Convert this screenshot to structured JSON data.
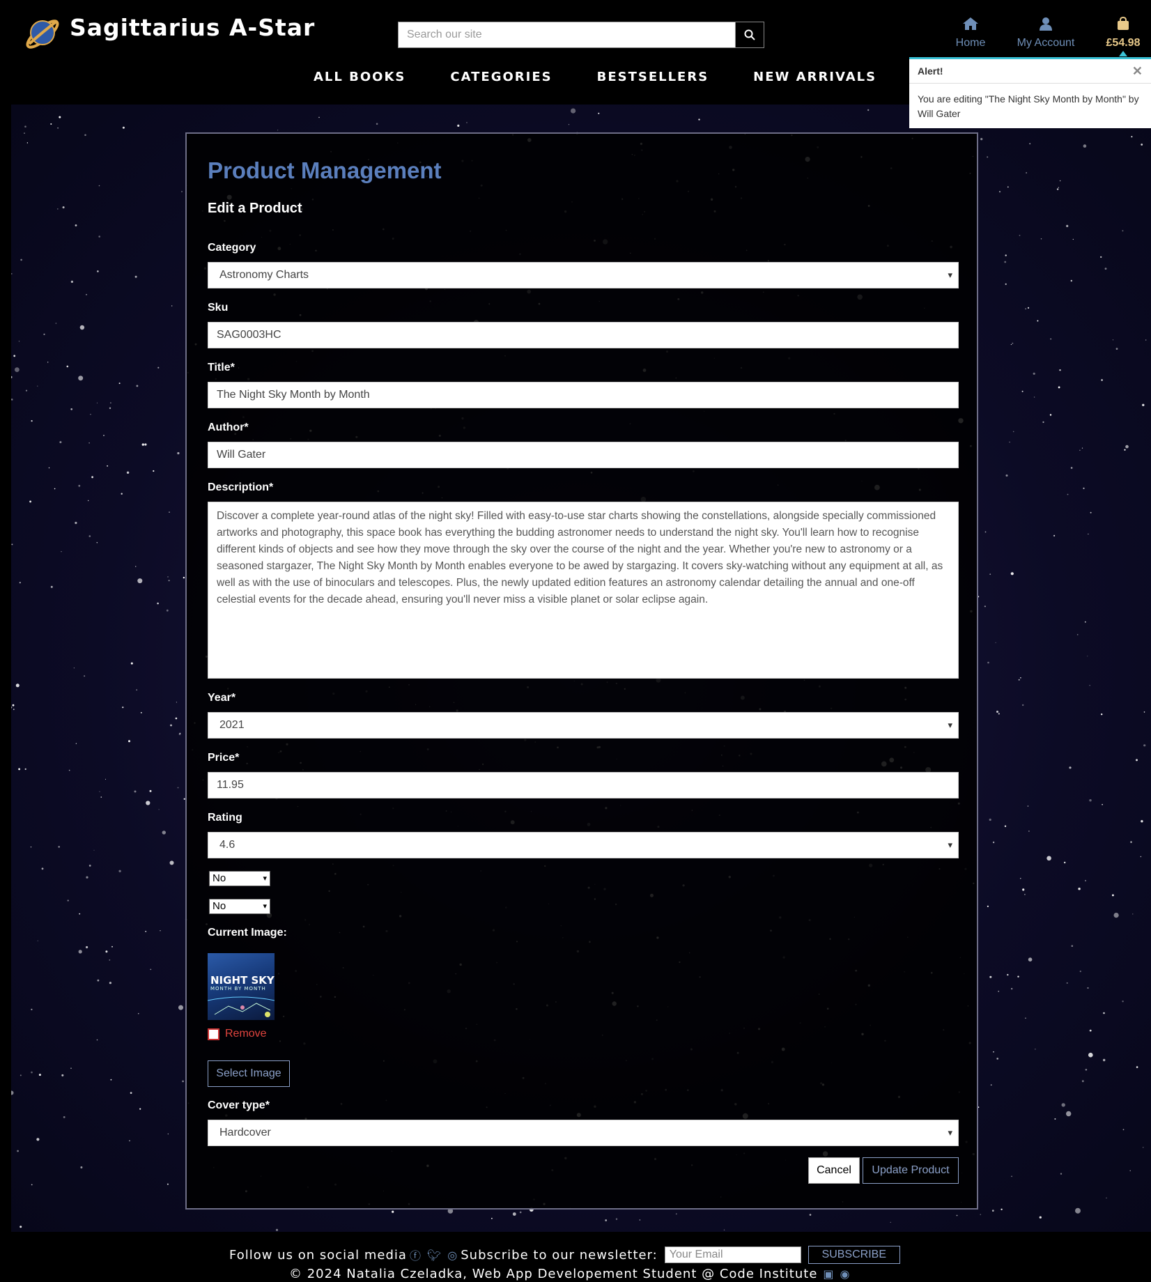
{
  "brand": {
    "name": "Sagittarius A-Star"
  },
  "search": {
    "placeholder": "Search our site"
  },
  "top_nav": {
    "home_label": "Home",
    "account_label": "My Account",
    "bag_total": "£54.98"
  },
  "main_menu": [
    "ALL BOOKS",
    "CATEGORIES",
    "BESTSELLERS",
    "NEW ARRIVALS"
  ],
  "alert": {
    "title": "Alert!",
    "message": "You are editing \"The Night Sky Month by Month\" by Will Gater"
  },
  "form": {
    "title": "Product Management",
    "subtitle": "Edit a Product",
    "category_label": "Category",
    "category_value": "Astronomy Charts",
    "sku_label": "Sku",
    "sku_value": "SAG0003HC",
    "title_label": "Title*",
    "title_value": "The Night Sky Month by Month",
    "author_label": "Author*",
    "author_value": "Will Gater",
    "description_label": "Description*",
    "description_value": "Discover a complete year-round atlas of the night sky! Filled with easy-to-use star charts showing the constellations, alongside specially commissioned artworks and photography, this space book has everything the budding astronomer needs to understand the night sky. You'll learn how to recognise different kinds of objects and see how they move through the sky over the course of the night and the year. Whether you're new to astronomy or a seasoned stargazer, The Night Sky Month by Month enables everyone to be awed by stargazing. It covers sky-watching without any equipment at all, as well as with the use of binoculars and telescopes. Plus, the newly updated edition features an astronomy calendar detailing the annual and one-off celestial events for the decade ahead, ensuring you'll never miss a visible planet or solar eclipse again.",
    "year_label": "Year*",
    "year_value": "2021",
    "price_label": "Price*",
    "price_value": "11.95",
    "rating_label": "Rating",
    "rating_value": "4.6",
    "flag1_value": "No",
    "flag2_value": "No",
    "current_image_label": "Current Image:",
    "thumb_title": "NIGHT SKY",
    "thumb_subtitle": "MONTH BY MONTH",
    "remove_label": "Remove",
    "select_image_label": "Select Image",
    "cover_type_label": "Cover type*",
    "cover_type_value": "Hardcover",
    "cancel_label": "Cancel",
    "update_label": "Update Product"
  },
  "footer": {
    "follow_text": "Follow us on social media",
    "subscribe_text": "Subscribe to our newsletter:",
    "email_placeholder": "Your Email",
    "subscribe_button": "SUBSCRIBE",
    "copyright": "© 2024 Natalia Czeladka, Web App Developement Student @ Code Institute"
  },
  "colors": {
    "accent_blue": "#5b7fbd",
    "icon_blue": "#6f8fb8",
    "bag_gold": "#e8c98a",
    "alert_bar": "#3ac2d6",
    "remove_red": "#e0443e"
  }
}
